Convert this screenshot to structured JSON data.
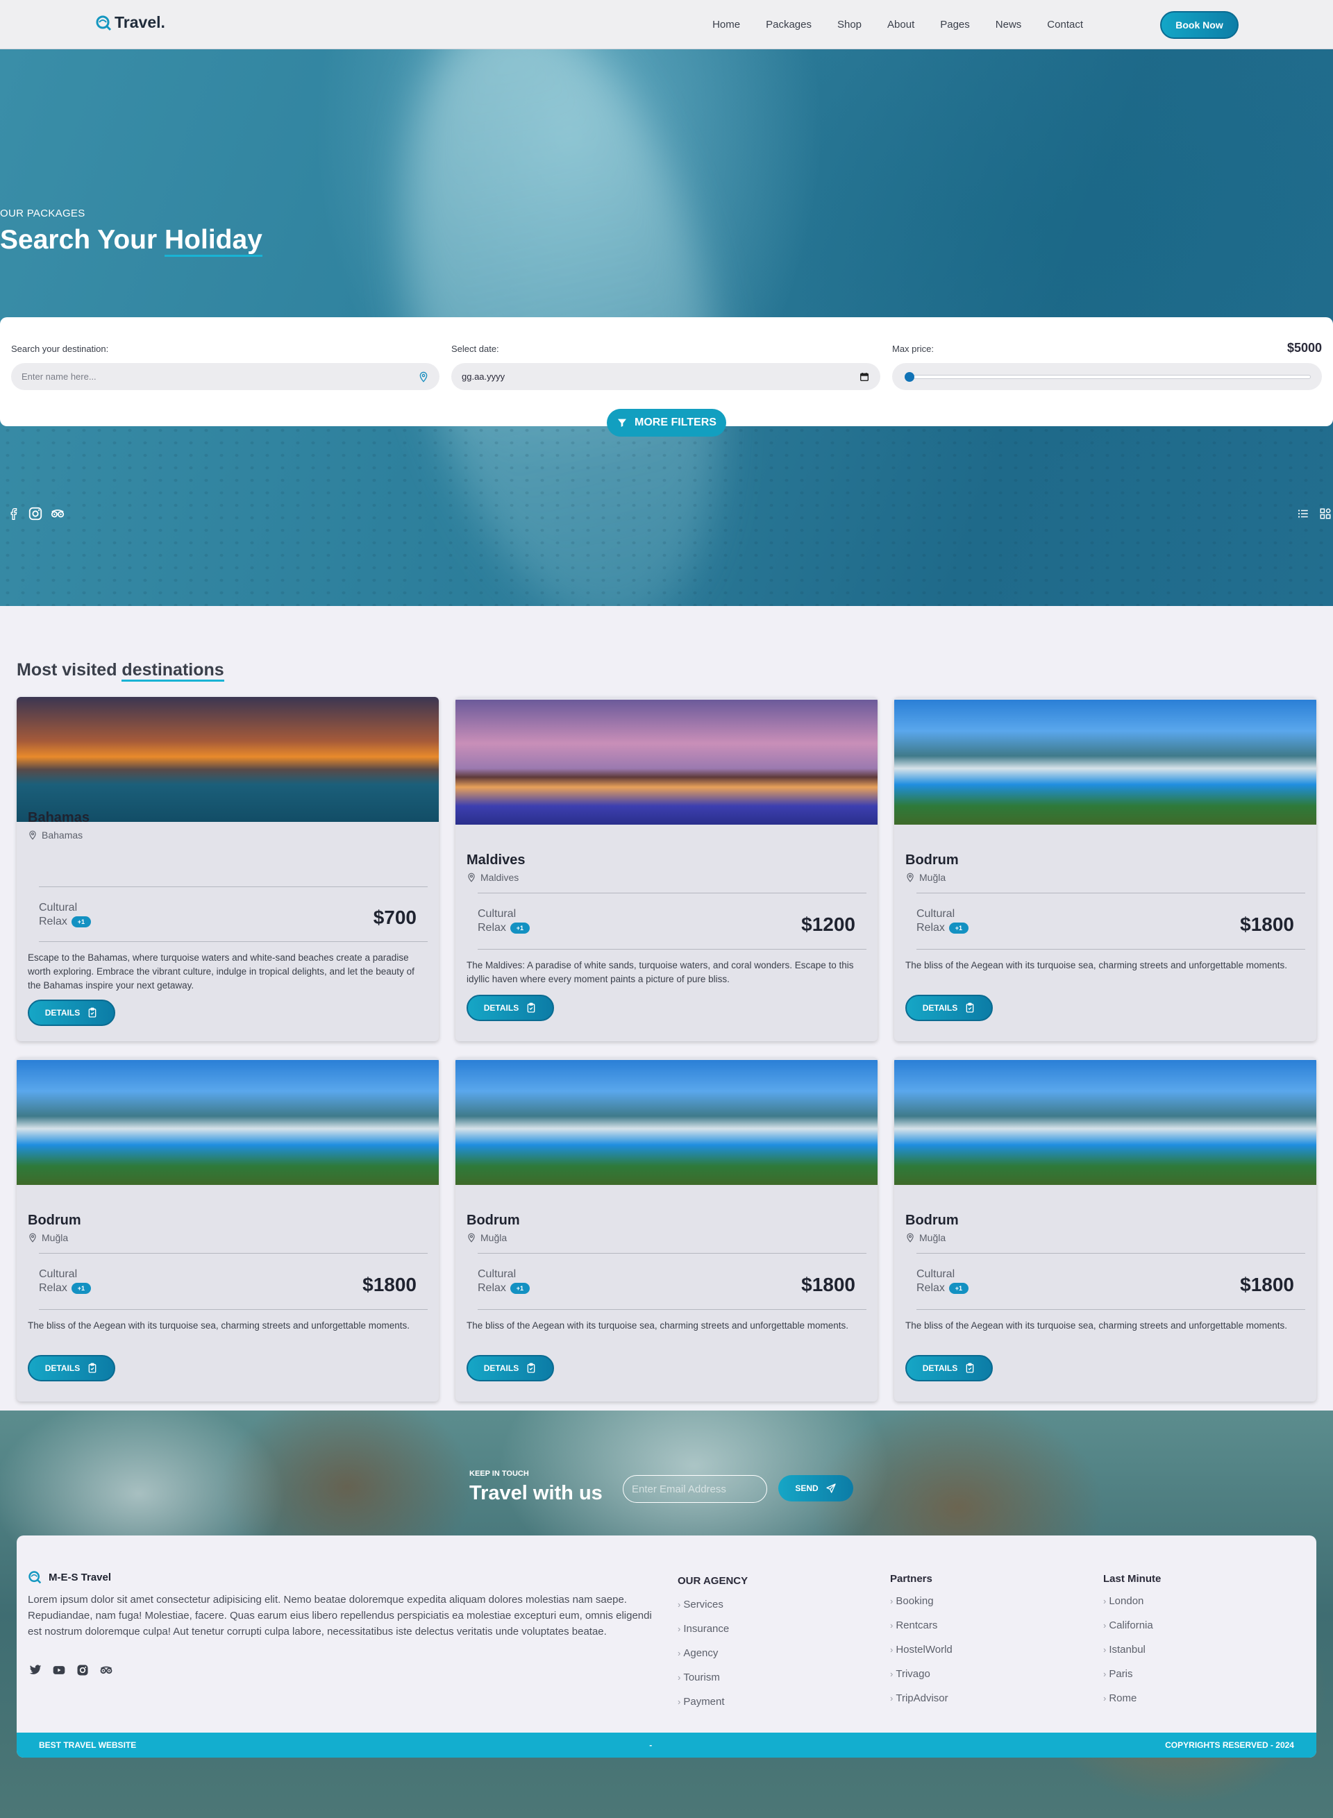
{
  "header": {
    "logo": "Travel.",
    "nav": [
      "Home",
      "Packages",
      "Shop",
      "About",
      "Pages",
      "News",
      "Contact"
    ],
    "book_now": "Book Now"
  },
  "hero": {
    "eyebrow": "OUR PACKAGES",
    "title_pre": "Search Your ",
    "title_hl": "Holiday"
  },
  "search": {
    "destination_label": "Search your destination:",
    "destination_placeholder": "Enter name here...",
    "date_label": "Select date:",
    "date_value": "gg.aa.yyyy",
    "price_label": "Max price:",
    "price_value": "$5000",
    "price_slider_fraction": 0.0,
    "more_filters": "MORE FILTERS"
  },
  "destinations": {
    "title_pre": "Most visited ",
    "title_hl": "destinations",
    "cards": [
      {
        "title": "Bahamas",
        "location": "Bahamas",
        "tag1": "Cultural",
        "tag2": "Relax",
        "badge": "+1",
        "price": "$700",
        "desc": "Escape to the Bahamas, where turquoise waters and white-sand beaches create a paradise worth exploring. Embrace the vibrant culture, indulge in tropical delights, and let the beauty of the Bahamas inspire your next getaway.",
        "details": "DETAILS"
      },
      {
        "title": "Maldives",
        "location": "Maldives",
        "tag1": "Cultural",
        "tag2": "Relax",
        "badge": "+1",
        "price": "$1200",
        "desc": "The Maldives: A paradise of white sands, turquoise waters, and coral wonders. Escape to this idyllic haven where every moment paints a picture of pure bliss.",
        "details": "DETAILS"
      },
      {
        "title": "Bodrum",
        "location": "Muğla",
        "tag1": "Cultural",
        "tag2": "Relax",
        "badge": "+1",
        "price": "$1800",
        "desc": "The bliss of the Aegean with its turquoise sea, charming streets and unforgettable moments.",
        "details": "DETAILS"
      },
      {
        "title": "Bodrum",
        "location": "Muğla",
        "tag1": "Cultural",
        "tag2": "Relax",
        "badge": "+1",
        "price": "$1800",
        "desc": "The bliss of the Aegean with its turquoise sea, charming streets and unforgettable moments.",
        "details": "DETAILS"
      },
      {
        "title": "Bodrum",
        "location": "Muğla",
        "tag1": "Cultural",
        "tag2": "Relax",
        "badge": "+1",
        "price": "$1800",
        "desc": "The bliss of the Aegean with its turquoise sea, charming streets and unforgettable moments.",
        "details": "DETAILS"
      },
      {
        "title": "Bodrum",
        "location": "Muğla",
        "tag1": "Cultural",
        "tag2": "Relax",
        "badge": "+1",
        "price": "$1800",
        "desc": "The bliss of the Aegean with its turquoise sea, charming streets and unforgettable moments.",
        "details": "DETAILS"
      }
    ]
  },
  "newsletter": {
    "eyebrow": "KEEP IN TOUCH",
    "title": "Travel with us",
    "email_placeholder": "Enter Email Address",
    "send": "SEND"
  },
  "footer": {
    "brand": "M-E-S Travel",
    "about": "Lorem ipsum dolor sit amet consectetur adipisicing elit. Nemo beatae doloremque expedita aliquam dolores molestias nam saepe. Repudiandae, nam fuga! Molestiae, facere. Quas earum eius libero repellendus perspiciatis ea molestiae excepturi eum, omnis eligendi est nostrum doloremque culpa! Aut tenetur corrupti culpa labore, necessitatibus iste delectus veritatis unde voluptates beatae.",
    "agency_title": "OUR AGENCY",
    "agency": [
      "Services",
      "Insurance",
      "Agency",
      "Tourism",
      "Payment"
    ],
    "partners_title": "Partners",
    "partners": [
      "Booking",
      "Rentcars",
      "HostelWorld",
      "Trivago",
      "TripAdvisor"
    ],
    "lastminute_title": "Last Minute",
    "lastminute": [
      "London",
      "California",
      "Istanbul",
      "Paris",
      "Rome"
    ],
    "bar_left": "BEST TRAVEL WEBSITE",
    "bar_mid": "-",
    "bar_right": "COPYRIGHTS RESERVED - 2024"
  },
  "colors": {
    "accent": "#13a6c7",
    "accent_dark": "#0c7ca6",
    "page_bg": "#f1f0f6"
  }
}
